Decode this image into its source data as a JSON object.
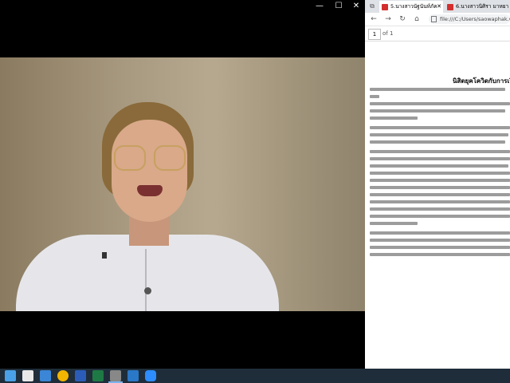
{
  "video_window": {
    "controls": {
      "minimize": "—",
      "maximize": "☐",
      "close": "✕"
    }
  },
  "browser": {
    "tabs": [
      {
        "label": "5.นางสาวนัฐนันท์ภัค",
        "active": true
      },
      {
        "label": "6.นางสาวนิศิรา มาหยา",
        "active": false
      }
    ],
    "address": "file:///C:/Users/saowaphak.wa/Des",
    "pdf": {
      "page": "1",
      "of": "of 1"
    },
    "doc_title": "นิสิตยุคโควิดกับการเรียนออนไลน์"
  },
  "taskbar": {
    "items": [
      "windows-icon",
      "store-icon",
      "mail-icon",
      "chrome-icon",
      "word-icon",
      "excel-icon",
      "video-app-icon",
      "media-icon",
      "zoom-icon"
    ]
  },
  "colors": {
    "taskbar": "#1f2d3a",
    "tab_bar": "#dee1e6",
    "pdf_icon": "#d32f2f"
  }
}
